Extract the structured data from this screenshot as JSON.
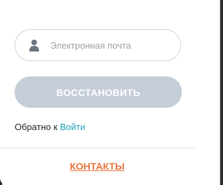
{
  "form": {
    "email_placeholder": "Электронная почта",
    "email_value": "",
    "user_icon": "user-icon",
    "restore_label": "ВОССТАНОВИТЬ",
    "back_prefix": "Обратно к ",
    "login_link": "Войти"
  },
  "footer": {
    "contacts_label": "КОНТАКТЫ"
  },
  "colors": {
    "button_bg": "#c4cdd8",
    "link": "#1aa3b8",
    "contacts": "#e8733a"
  }
}
